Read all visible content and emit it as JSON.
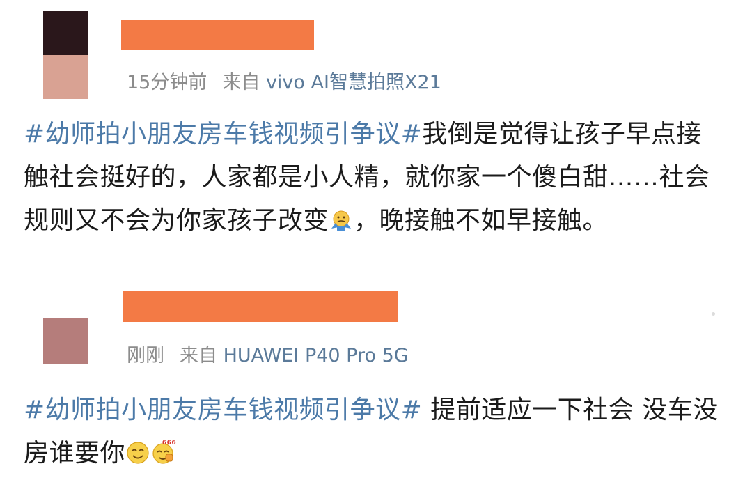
{
  "posts": [
    {
      "avatar_colors": [
        "#2a171b",
        "#d9a293"
      ],
      "username_redaction_color": "#f37a45",
      "time": "15分钟前",
      "source_prefix": "来自",
      "source": "vivo AI智慧拍照X21",
      "topic": "#幼师拍小朋友房车钱视频引争议#",
      "text_before_emoji": "我倒是觉得让孩子早点接触社会挺好的，人家都是小人精，就你家一个傻白甜……社会规则又不会为你家孩子改变",
      "emojis": [
        "shrug-emoji"
      ],
      "text_after_emoji": "，晚接触不如早接触。"
    },
    {
      "avatar_colors": [
        "#b57d7b"
      ],
      "username_redaction_color": "#f37a45",
      "time": "刚刚",
      "source_prefix": "来自",
      "source": "HUAWEI P40 Pro 5G",
      "topic": "#幼师拍小朋友房车钱视频引争议#",
      "text_before_emoji": " 提前适应一下社会 没车没房谁要你",
      "emojis": [
        "smile-emoji",
        "666-emoji"
      ],
      "emoji_text": "666",
      "text_after_emoji": ""
    }
  ],
  "colors": {
    "topic": "#4c7aa8",
    "meta_text": "#8c8c8c",
    "source_text": "#5b7a99",
    "body_text": "#1b1b1b",
    "background": "#ffffff"
  }
}
